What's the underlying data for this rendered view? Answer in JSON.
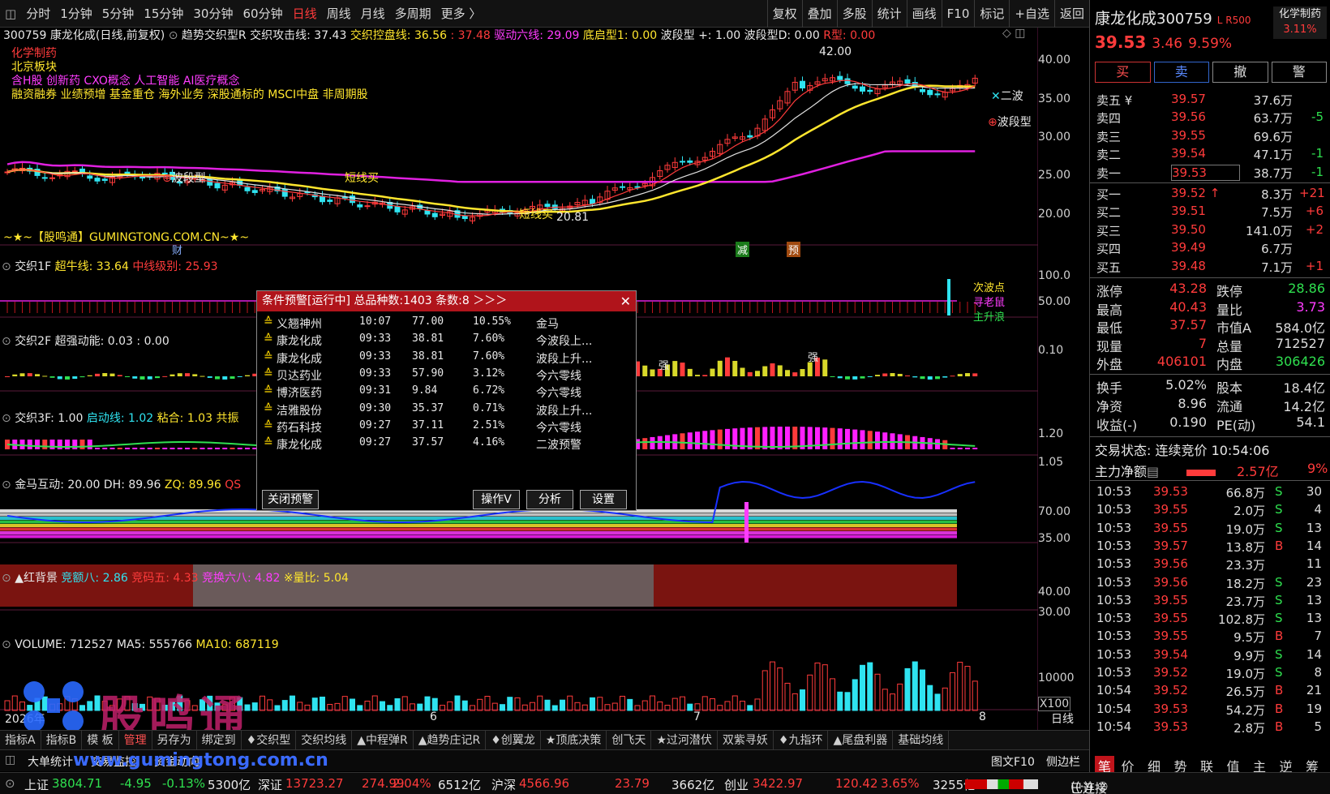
{
  "periods": [
    "分时",
    "1分钟",
    "5分钟",
    "15分钟",
    "30分钟",
    "60分钟",
    "日线",
    "周线",
    "月线",
    "多周期",
    "更多 〉"
  ],
  "active_period": "日线",
  "tools": [
    "复权",
    "叠加",
    "多股",
    "统计",
    "画线",
    "F10",
    "标记",
    "+自选",
    "返回"
  ],
  "header": {
    "code_name": "300759 康龙化成(日线,前复权)",
    "indicator": "趋势交织型R",
    "attack_label": "交织攻击线: 37.43",
    "control_label": "交织控盘线: 36.56",
    "control_value2": ": 37.48",
    "drive_label": "驱动六线: 29.09",
    "bottom_label": "底启型1: 0.00",
    "wave_label": "波段型 +: 1.00",
    "waveD_label": "波段型D: 0.00",
    "r_label": "R型: 0.00"
  },
  "concepts": {
    "line1": "化学制药",
    "line2": "北京板块",
    "line3": "含H股 创新药 CXO概念 人工智能 AI医疗概念",
    "line4": "融资融券 业绩预增 基金重仓 海外业务 深股通标的 MSCI中盘 非周期股"
  },
  "chart_annotations": {
    "high": "42.00",
    "low": "20.81",
    "wave1": "波段型",
    "wave2": "波段型",
    "short_buy1": "短线买",
    "short_buy2": "短线买",
    "second_wave": "二波",
    "watermark": "~★~【股鸣通】GUMINGTONG.COM.CN~★~",
    "cai": "财",
    "jian": "减",
    "yu": "预"
  },
  "price_axis": [
    "40.00",
    "35.00",
    "30.00",
    "25.00",
    "20.00"
  ],
  "panels": {
    "p1": {
      "name": "交织1F",
      "a": "超牛线: 33.64",
      "b": "中线级别: 25.93",
      "axis": [
        "100.0",
        "50.00"
      ],
      "labels": [
        "次波点",
        "寻老鼠",
        "主升浪"
      ]
    },
    "p2": {
      "name": "交织2F",
      "a": "超强动能: 0.03 : 0.00",
      "axis": [
        "0.10"
      ],
      "qiang": "强"
    },
    "p3": {
      "name": "交织3F",
      "a": ": 1.00",
      "b": "启动线: 1.02",
      "c": "粘合: 1.03",
      "d": "共振",
      "axis": [
        "1.20",
        "1.05"
      ]
    },
    "p4": {
      "name": "金马互动",
      "a": ": 20.00",
      "b": "DH: 89.96",
      "c": "ZQ: 89.96",
      "d": "QS",
      "axis": [
        "70.00",
        "35.00"
      ]
    },
    "p5": {
      "name": "▲红背景",
      "a": "竞额八: 2.86",
      "b": "竞码五: 4.33",
      "c": "竞换六八: 4.82",
      "d": "※量比: 5.04",
      "axis": [
        "40.00",
        "30.00"
      ]
    },
    "p6": {
      "name": "VOLUME: 712527",
      "a": "MA5: 555766",
      "b": "MA10: 687119",
      "axis": [
        "10000",
        "X100"
      ]
    }
  },
  "date_axis": {
    "year": "2026年",
    "m6": "6",
    "m7": "7",
    "m8": "8",
    "unit": "日线"
  },
  "dialog": {
    "title": "条件预警[运行中] 总品种数:1403 条数:8 ＞＞＞",
    "rows": [
      {
        "name": "义翘神州",
        "time": "10:07",
        "price": "77.00",
        "pct": "10.55%",
        "cond": "金马"
      },
      {
        "name": "康龙化成",
        "time": "09:33",
        "price": "38.81",
        "pct": "7.60%",
        "cond": "今波段上..."
      },
      {
        "name": "康龙化成",
        "time": "09:33",
        "price": "38.81",
        "pct": "7.60%",
        "cond": "波段上升..."
      },
      {
        "name": "贝达药业",
        "time": "09:33",
        "price": "57.90",
        "pct": "3.12%",
        "cond": "今六零线"
      },
      {
        "name": "博济医药",
        "time": "09:31",
        "price": "9.84",
        "pct": "6.72%",
        "cond": "今六零线"
      },
      {
        "name": "洁雅股份",
        "time": "09:30",
        "price": "35.37",
        "pct": "0.71%",
        "cond": "波段上升..."
      },
      {
        "name": "药石科技",
        "time": "09:27",
        "price": "37.11",
        "pct": "2.51%",
        "cond": "今六零线"
      },
      {
        "name": "康龙化成",
        "time": "09:27",
        "price": "37.57",
        "pct": "4.16%",
        "cond": "二波预警"
      }
    ],
    "close_btn": "关闭预警",
    "op_btn": "操作V",
    "analyze_btn": "分析",
    "settings_btn": "设置"
  },
  "bottom_tabs": [
    "指标A",
    "指标B",
    "模 板",
    "管理",
    "另存为",
    "绑定到",
    "♦交织型",
    "交织均线",
    "▲中程弹R",
    "▲趋势庄记R",
    "♦创翼龙",
    "★顶底决策",
    "创飞天",
    "★过河潜伏",
    "双紫寻妖",
    "♦九指环",
    "▲尾盘利器",
    "基础均线"
  ],
  "bottom2": {
    "a": "大单统计",
    "b": "交易监控",
    "c": "资金动向",
    "url": "www.gumingtong.com.cn",
    "d": "图文F10",
    "e": "侧边栏"
  },
  "brand": "股鸣通",
  "stock": {
    "name": "康龙化成",
    "code": "300759",
    "tag": "L R500",
    "sector": "化学制药",
    "sector_pct": "3.11%",
    "price": "39.53",
    "change": "3.46",
    "pct": "9.59%"
  },
  "trade_buttons": [
    "买",
    "卖",
    "撤",
    "警"
  ],
  "asks": [
    {
      "label": "卖五 ¥",
      "price": "39.57",
      "vol": "37.6万",
      "chg": ""
    },
    {
      "label": "卖四",
      "price": "39.56",
      "vol": "63.7万",
      "chg": "-5"
    },
    {
      "label": "卖三",
      "price": "39.55",
      "vol": "69.6万",
      "chg": ""
    },
    {
      "label": "卖二",
      "price": "39.54",
      "vol": "47.1万",
      "chg": "-1"
    },
    {
      "label": "卖一",
      "price": "39.53",
      "vol": "38.7万",
      "chg": "-1"
    }
  ],
  "bids": [
    {
      "label": "买一",
      "price": "39.52 ↑",
      "vol": "8.3万",
      "chg": "+21"
    },
    {
      "label": "买二",
      "price": "39.51",
      "vol": "7.5万",
      "chg": "+6"
    },
    {
      "label": "买三",
      "price": "39.50",
      "vol": "141.0万",
      "chg": "+2"
    },
    {
      "label": "买四",
      "price": "39.49",
      "vol": "6.7万",
      "chg": ""
    },
    {
      "label": "买五",
      "price": "39.48",
      "vol": "7.1万",
      "chg": "+1"
    }
  ],
  "stats": [
    {
      "k1": "涨停",
      "v1": "43.28",
      "k2": "跌停",
      "v2": "28.86"
    },
    {
      "k1": "最高",
      "v1": "40.43",
      "k2": "量比",
      "v2": "3.73"
    },
    {
      "k1": "最低",
      "v1": "37.57",
      "k2": "市值A",
      "v2": "584.0亿"
    },
    {
      "k1": "现量",
      "v1": "7",
      "k2": "总量",
      "v2": "712527"
    },
    {
      "k1": "外盘",
      "v1": "406101",
      "k2": "内盘",
      "v2": "306426"
    }
  ],
  "stats2": [
    {
      "k1": "换手",
      "v1": "5.02%",
      "k2": "股本",
      "v2": "18.4亿"
    },
    {
      "k1": "净资",
      "v1": "8.96",
      "k2": "流通",
      "v2": "14.2亿"
    },
    {
      "k1": "收益(-)",
      "v1": "0.190",
      "k2": "PE(动)",
      "v2": "54.1"
    }
  ],
  "trade_status": "交易状态: 连续竞价 10:54:06",
  "main_net": {
    "label": "主力净额",
    "value": "2.57亿",
    "pct": "9%"
  },
  "ticks": [
    {
      "t": "10:53",
      "p": "39.53",
      "v": "66.8万",
      "s": "S",
      "n": "30"
    },
    {
      "t": "10:53",
      "p": "39.55",
      "v": "2.0万",
      "s": "S",
      "n": "4"
    },
    {
      "t": "10:53",
      "p": "39.55",
      "v": "19.0万",
      "s": "S",
      "n": "13"
    },
    {
      "t": "10:53",
      "p": "39.57",
      "v": "13.8万",
      "s": "B",
      "n": "14"
    },
    {
      "t": "10:53",
      "p": "39.56",
      "v": "23.3万",
      "s": "",
      "n": "11"
    },
    {
      "t": "10:53",
      "p": "39.56",
      "v": "18.2万",
      "s": "S",
      "n": "23"
    },
    {
      "t": "10:53",
      "p": "39.55",
      "v": "23.7万",
      "s": "S",
      "n": "13"
    },
    {
      "t": "10:53",
      "p": "39.55",
      "v": "102.8万",
      "s": "S",
      "n": "13"
    },
    {
      "t": "10:53",
      "p": "39.55",
      "v": "9.5万",
      "s": "B",
      "n": "7"
    },
    {
      "t": "10:53",
      "p": "39.54",
      "v": "9.9万",
      "s": "S",
      "n": "14"
    },
    {
      "t": "10:53",
      "p": "39.52",
      "v": "19.0万",
      "s": "S",
      "n": "8"
    },
    {
      "t": "10:54",
      "p": "39.52",
      "v": "26.5万",
      "s": "B",
      "n": "21"
    },
    {
      "t": "10:54",
      "p": "39.53",
      "v": "54.2万",
      "s": "B",
      "n": "19"
    },
    {
      "t": "10:54",
      "p": "39.53",
      "v": "2.8万",
      "s": "B",
      "n": "5"
    }
  ],
  "right_tabs": [
    "笔",
    "价",
    "细",
    "势",
    "联",
    "值",
    "主",
    "逆",
    "筹"
  ],
  "status_bar": {
    "sh": "上证",
    "sh_v": "3804.71",
    "sh_c": "-4.95",
    "sh_p": "-0.13%",
    "sh_a": "5300亿",
    "sz": "深证",
    "sz_v": "13723.27",
    "sz_c": "274.99",
    "sz_p": "2.04%",
    "sz_a": "6512亿",
    "hs": "沪深",
    "hs_v": "4566.96",
    "hs_c": "23.79",
    "hs_a": "3662亿",
    "cy": "创业",
    "cy_v": "3422.97",
    "cy_c": "120.42",
    "cy_p": "3.65%",
    "cy_a": "3255亿",
    "conn": "已连接"
  },
  "colors": {
    "up": "#ff3b3b",
    "down": "#2fe3f0",
    "ma_yellow": "#ffe62e",
    "ma_magenta": "#e020e0",
    "ma_white": "#e0e0e0",
    "bg": "#000000"
  }
}
